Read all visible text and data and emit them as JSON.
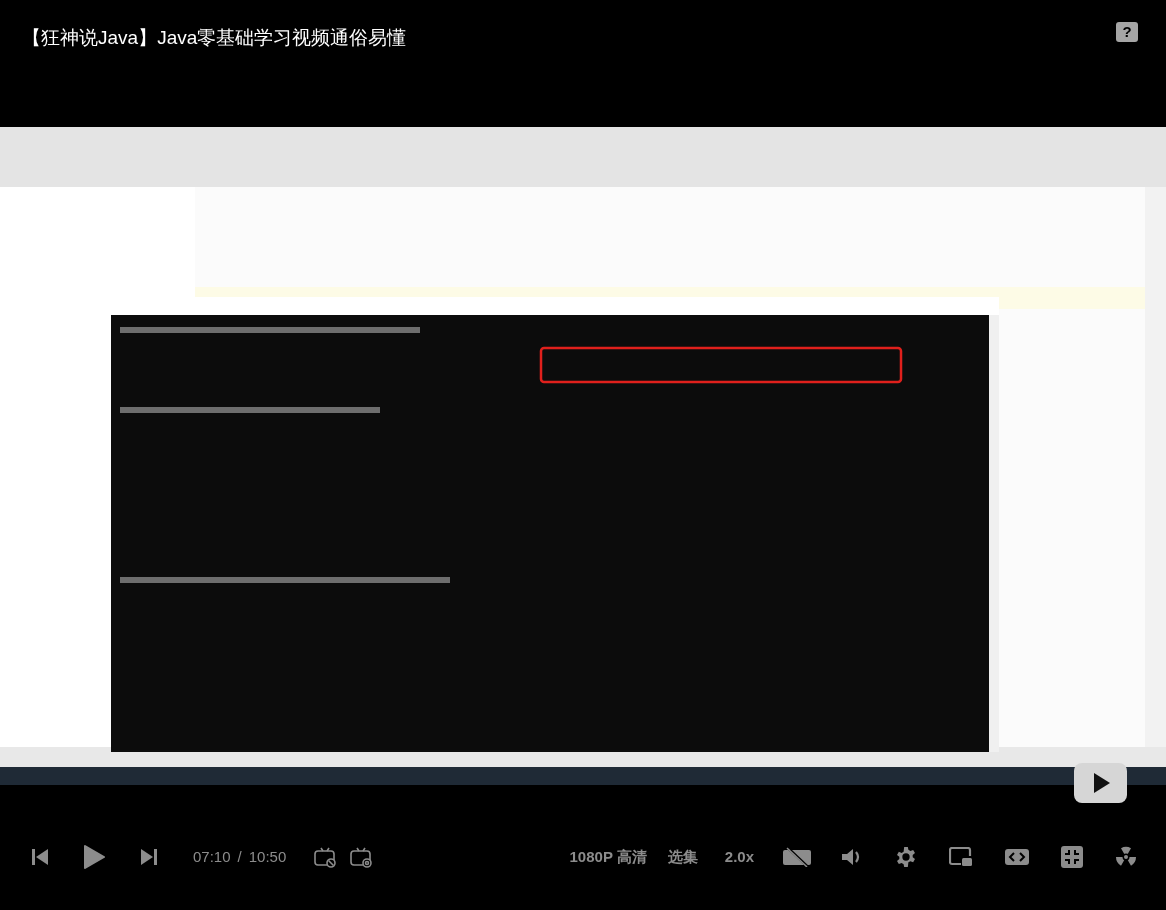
{
  "title": "【狂神说Java】Java零基础学习视频通俗易懂",
  "help_button": {
    "label": "?"
  },
  "controls": {
    "current_time": "07:10",
    "separator": "/",
    "duration": "10:50",
    "quality": "1080P 高清",
    "episodes": "选集",
    "speed": "2.0x"
  }
}
